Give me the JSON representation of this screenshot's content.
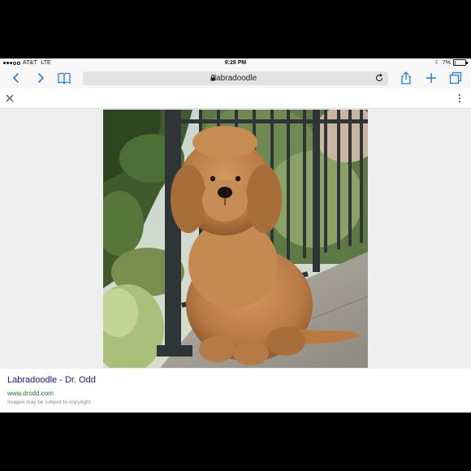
{
  "status_bar": {
    "carrier": "AT&T",
    "network": "LTE",
    "time": "9:28 PM",
    "battery_text": "7%",
    "battery_level": 0.07,
    "signal_bars": 3
  },
  "toolbar": {
    "url": "labradoodle",
    "icons": [
      "back-icon",
      "forward-icon",
      "bookmarks-icon",
      "lock-icon",
      "reload-icon",
      "share-icon",
      "add-icon",
      "tabs-icon"
    ]
  },
  "viewer": {
    "icons": [
      "close-icon",
      "more-icon"
    ],
    "image_subject": "labradoodle puppy sitting by an iron railing"
  },
  "result": {
    "title": "Labradoodle - Dr. Odd",
    "domain": "www.drodd.com",
    "note": "Images may be subject to copyright."
  },
  "colors": {
    "accent": "#1e7ae6",
    "link": "#1a0dab",
    "domain": "#1d7d2b"
  }
}
